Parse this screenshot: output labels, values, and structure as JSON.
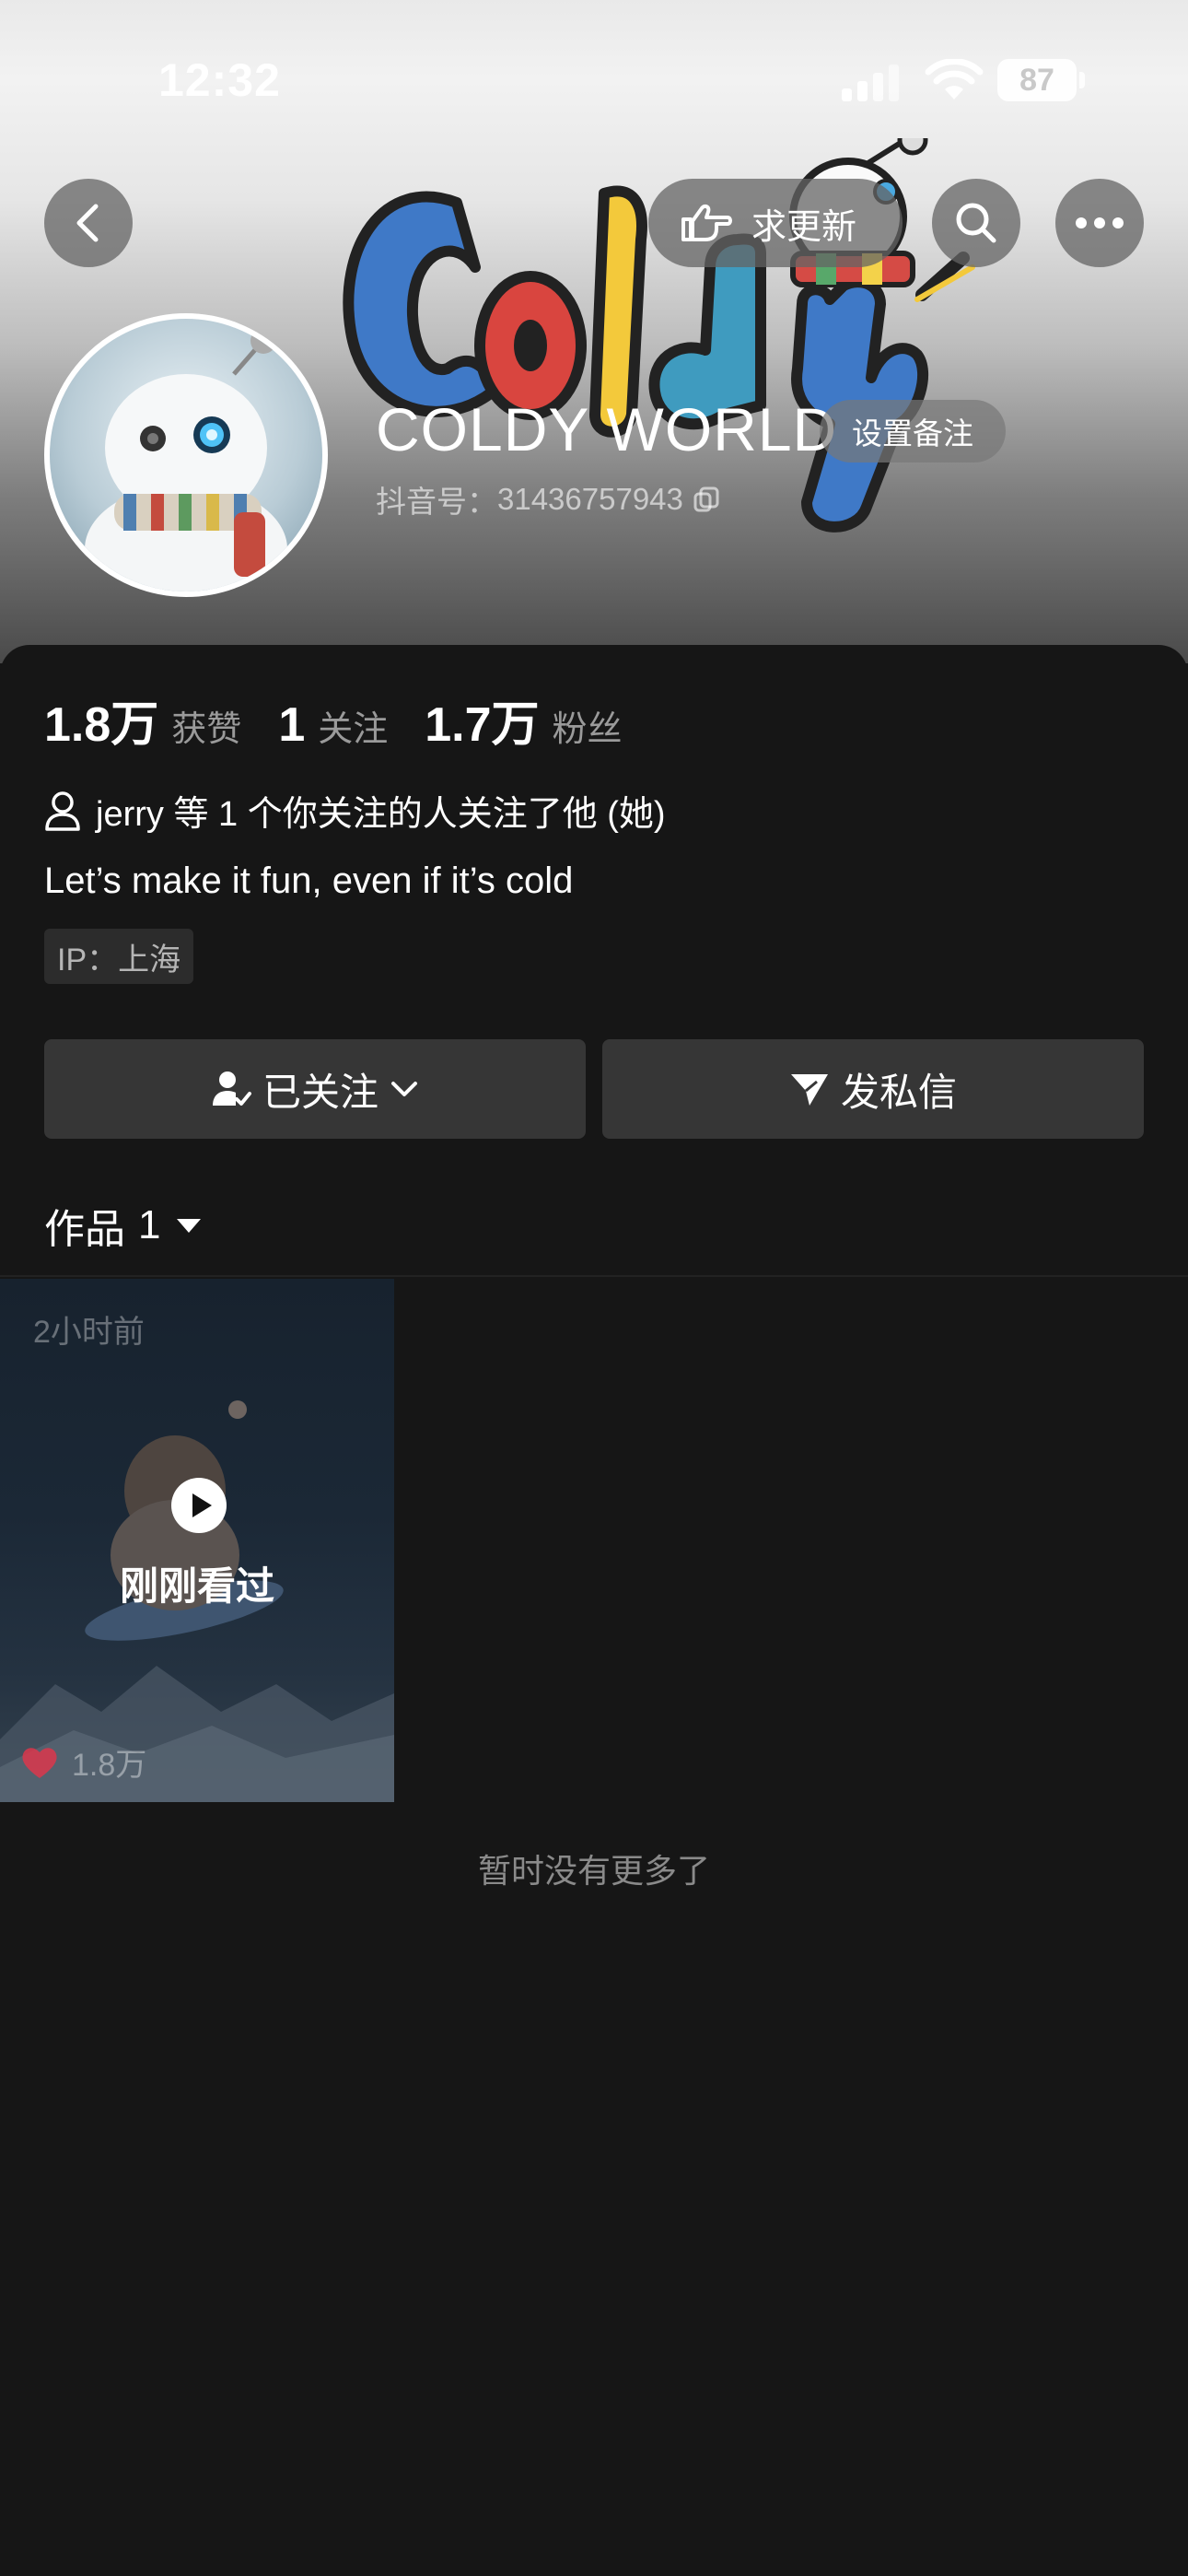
{
  "status_bar": {
    "time": "12:32",
    "battery": "87"
  },
  "header": {
    "update_label": "求更新"
  },
  "profile": {
    "name": "COLDY WORLD",
    "remark_button": "设置备注",
    "douyin_id_label": "抖音号：",
    "douyin_id": "31436757943",
    "logo_text": "Coldy"
  },
  "stats": [
    {
      "value": "1.8万",
      "label": "获赞"
    },
    {
      "value": "1",
      "label": "关注"
    },
    {
      "value": "1.7万",
      "label": "粉丝"
    }
  ],
  "mutual_follow": "jerry 等 1 个你关注的人关注了他 (她)",
  "bio": "Let’s make it fun, even if it’s cold",
  "ip": "IP：上海",
  "actions": {
    "follow_label": "已关注",
    "message_label": "发私信"
  },
  "works_tab": {
    "label": "作品",
    "count": "1"
  },
  "video": {
    "time_ago": "2小时前",
    "overlay": "刚刚看过",
    "likes": "1.8万"
  },
  "footer_text": "暂时没有更多了",
  "colors": {
    "background": "#161616",
    "button_bg": "#363636",
    "like_heart": "#e5344a",
    "logo_blue": "#3f79c7",
    "logo_red": "#d9453f",
    "logo_yellow": "#f3c93b",
    "logo_teal": "#3f9bbf"
  },
  "icons": [
    "back-icon",
    "pointing-hand-icon",
    "search-icon",
    "more-icon",
    "user-icon",
    "followed-user-icon",
    "chevron-down-icon",
    "send-icon",
    "caret-down-icon",
    "play-icon",
    "heart-icon",
    "copy-icon",
    "wifi-icon",
    "signal-icon"
  ]
}
